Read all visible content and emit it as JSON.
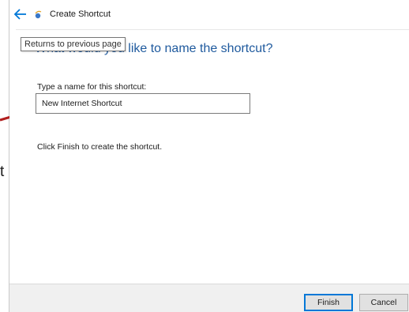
{
  "window": {
    "title": "Create Shortcut",
    "back_icon": "back-arrow-icon",
    "app_icon": "shortcut-icon"
  },
  "tooltip": {
    "text": "Returns to previous page"
  },
  "page": {
    "heading": "What would you like to name the shortcut?",
    "field_label": "Type a name for this shortcut:",
    "name_value": "New Internet Shortcut",
    "instruction": "Click Finish to create the shortcut."
  },
  "buttons": {
    "finish_label": "Finish",
    "cancel_label": "Cancel"
  },
  "annotation": {
    "letter": "t",
    "arrow_color": "#b01e1e"
  },
  "colors": {
    "accent": "#0078d7",
    "heading": "#1f5a9e",
    "back_arrow": "#0078d7"
  }
}
